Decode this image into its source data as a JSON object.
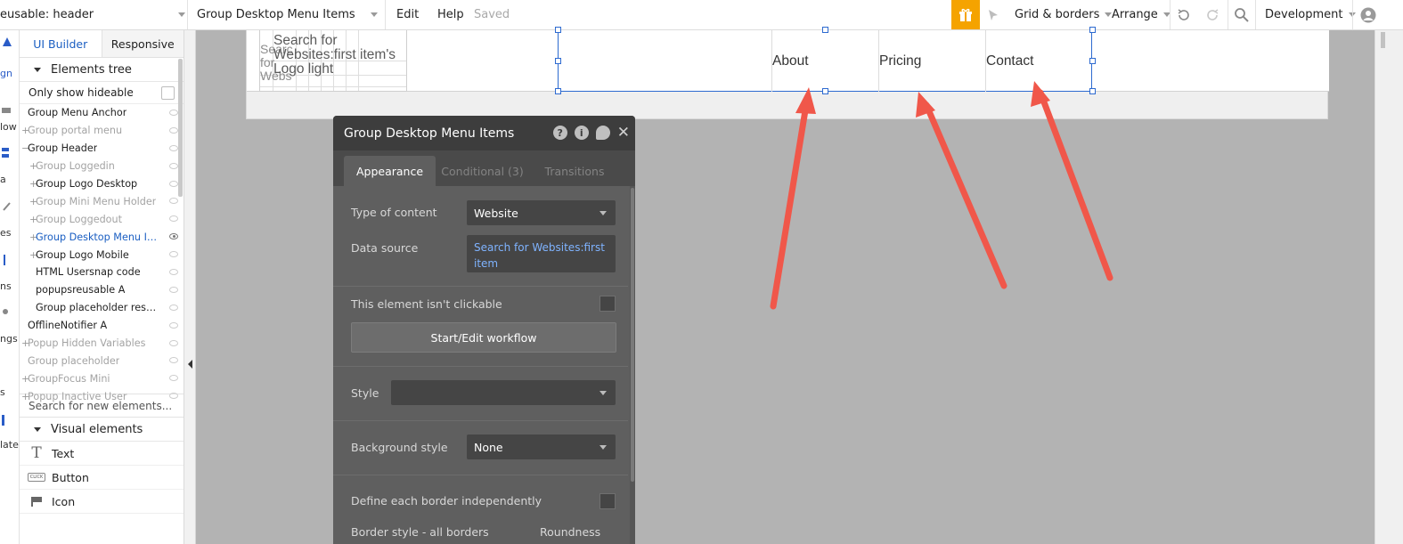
{
  "topbar": {
    "page_name": "eusable: header",
    "element_name": "Group Desktop Menu Items",
    "edit": "Edit",
    "help": "Help",
    "saved": "Saved",
    "grid_borders": "Grid & borders",
    "arrange": "Arrange",
    "environment": "Development",
    "gift_color": "#f5a300"
  },
  "left_strip": {
    "labels": [
      "gn",
      "low",
      "a",
      "es",
      "ns",
      "ngs",
      "s",
      "late"
    ]
  },
  "panel": {
    "tabs": [
      "UI Builder",
      "Responsive"
    ],
    "elements_tree": "Elements tree",
    "only_show_hideable": "Only show hideable",
    "tree": [
      {
        "label": "Group Menu Anchor",
        "plus": false,
        "indent": 0,
        "color": "black"
      },
      {
        "label": "Group portal menu",
        "plus": true,
        "indent": 0,
        "color": "gray"
      },
      {
        "label": "Group Header",
        "plus": true,
        "indent": 0,
        "color": "black",
        "minus": true
      },
      {
        "label": "Group Loggedin",
        "plus": true,
        "indent": 1,
        "color": "gray"
      },
      {
        "label": "Group Logo Desktop",
        "plus": true,
        "indent": 1,
        "color": "black"
      },
      {
        "label": "Group Mini Menu Holder",
        "plus": true,
        "indent": 1,
        "color": "gray"
      },
      {
        "label": "Group Loggedout",
        "plus": true,
        "indent": 1,
        "color": "gray"
      },
      {
        "label": "Group Desktop Menu Ite...",
        "plus": true,
        "indent": 1,
        "color": "blue"
      },
      {
        "label": "Group Logo Mobile",
        "plus": true,
        "indent": 1,
        "color": "black"
      },
      {
        "label": "HTML Usersnap code",
        "plus": false,
        "indent": 1,
        "color": "black"
      },
      {
        "label": "popupsreusable A",
        "plus": false,
        "indent": 1,
        "color": "black"
      },
      {
        "label": "Group placeholder respo...",
        "plus": false,
        "indent": 1,
        "color": "black"
      },
      {
        "label": "OfflineNotifier A",
        "plus": false,
        "indent": 0,
        "color": "black"
      },
      {
        "label": "Popup Hidden Variables",
        "plus": true,
        "indent": 0,
        "color": "gray"
      },
      {
        "label": "Group placeholder",
        "plus": false,
        "indent": 0,
        "color": "gray"
      },
      {
        "label": "GroupFocus Mini",
        "plus": true,
        "indent": 0,
        "color": "gray"
      },
      {
        "label": "Popup Inactive User",
        "plus": true,
        "indent": 0,
        "color": "gray"
      }
    ],
    "search_placeholder": "Search for new elements...",
    "visual_elements": "Visual elements",
    "visual_items": [
      {
        "label": "Text",
        "icon": "text-icon"
      },
      {
        "label": "Button",
        "icon": "button-icon"
      },
      {
        "label": "Icon",
        "icon": "flag-icon"
      }
    ]
  },
  "canvas": {
    "logo_text": "Search for Websites:first item's Logo light",
    "logo_behind": "Searc for Webs",
    "menu": [
      "About",
      "Pricing",
      "Contact"
    ]
  },
  "editor": {
    "title": "Group Desktop Menu Items",
    "tabs": [
      "Appearance",
      "Conditional (3)",
      "Transitions"
    ],
    "type_of_content_label": "Type of content",
    "type_of_content_value": "Website",
    "data_source_label": "Data source",
    "data_source_value": "Search for Websites:first item",
    "not_clickable_label": "This element isn't clickable",
    "workflow_button": "Start/Edit workflow",
    "style_label": "Style",
    "style_value": "",
    "background_label": "Background style",
    "background_value": "None",
    "border_independent_label": "Define each border independently",
    "border_style_label": "Border style - all borders",
    "roundness_label": "Roundness",
    "link_color": "#7fb3ff"
  },
  "annotations": {
    "arrow_color": "#f0574a"
  }
}
